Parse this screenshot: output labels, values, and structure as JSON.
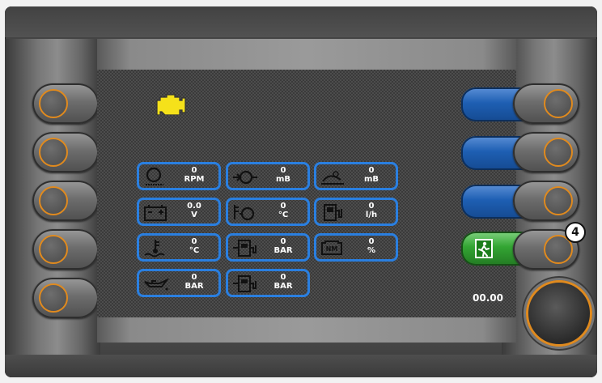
{
  "status": {
    "engine_icon": "engine-warning-icon",
    "engine_icon_color": "#f5e11a"
  },
  "gauges": [
    {
      "name": "engine-speed",
      "icon": "engine-rpm-icon",
      "value": "0",
      "unit": "RPM"
    },
    {
      "name": "turbo-pressure",
      "icon": "turbo-icon",
      "value": "0",
      "unit": "mB"
    },
    {
      "name": "ambient-pressure",
      "icon": "barometer-icon",
      "value": "0",
      "unit": "mB"
    },
    {
      "name": "battery-voltage",
      "icon": "battery-icon",
      "value": "0.0",
      "unit": "V"
    },
    {
      "name": "intake-temperature",
      "icon": "intake-temp-icon",
      "value": "0",
      "unit": "°C"
    },
    {
      "name": "fuel-rate",
      "icon": "fuel-rate-icon",
      "value": "0",
      "unit": "l/h"
    },
    {
      "name": "coolant-temperature",
      "icon": "coolant-temp-icon",
      "value": "0",
      "unit": "°C"
    },
    {
      "name": "fuel-pressure",
      "icon": "fuel-pressure-icon",
      "value": "0",
      "unit": "BAR"
    },
    {
      "name": "engine-load",
      "icon": "engine-load-icon",
      "value": "0",
      "unit": "%"
    },
    {
      "name": "oil-pressure",
      "icon": "oil-can-icon",
      "value": "0",
      "unit": "BAR"
    },
    {
      "name": "fuel-pressure-2",
      "icon": "fuel-pressure-icon",
      "value": "0",
      "unit": "BAR"
    }
  ],
  "load_icon_text": "NM",
  "clock": "00.00",
  "callout": "4",
  "colors": {
    "accent": "#e08a1e",
    "tile_border": "#2a7fe0",
    "softkey_blue": "#1e5fb3",
    "exit_green": "#33a533"
  }
}
